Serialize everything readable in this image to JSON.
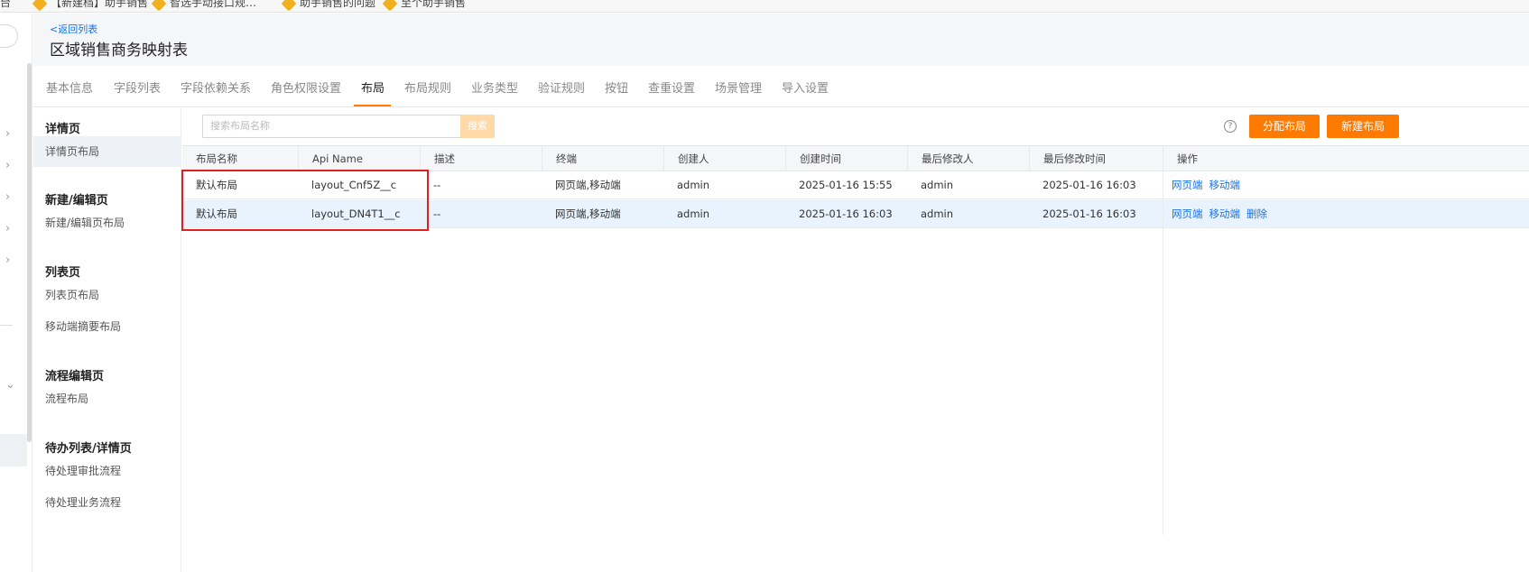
{
  "bookmarks": [
    "台",
    "【新建档】助手销售",
    "智选手动接口规…",
    "助手销售的问题",
    "至个助手销售"
  ],
  "header": {
    "back_label": "<返回列表",
    "title": "区域销售商务映射表"
  },
  "tabs": [
    {
      "label": "基本信息"
    },
    {
      "label": "字段列表"
    },
    {
      "label": "字段依赖关系"
    },
    {
      "label": "角色权限设置"
    },
    {
      "label": "布局",
      "active": true
    },
    {
      "label": "布局规则"
    },
    {
      "label": "业务类型"
    },
    {
      "label": "验证规则"
    },
    {
      "label": "按钮"
    },
    {
      "label": "查重设置"
    },
    {
      "label": "场景管理"
    },
    {
      "label": "导入设置"
    }
  ],
  "sidebar": {
    "sections": [
      {
        "title": "详情页",
        "items": [
          {
            "label": "详情页布局",
            "active": true
          }
        ]
      },
      {
        "title": "新建/编辑页",
        "items": [
          {
            "label": "新建/编辑页布局"
          }
        ]
      },
      {
        "title": "列表页",
        "items": [
          {
            "label": "列表页布局"
          },
          {
            "label": "移动端摘要布局"
          }
        ]
      },
      {
        "title": "流程编辑页",
        "items": [
          {
            "label": "流程布局"
          }
        ]
      },
      {
        "title": "待办列表/详情页",
        "items": [
          {
            "label": "待处理审批流程"
          },
          {
            "label": "待处理业务流程"
          }
        ]
      }
    ]
  },
  "toolbar": {
    "search_placeholder": "搜索布局名称",
    "search_button": "搜索",
    "assign_button": "分配布局",
    "new_button": "新建布局",
    "help_icon": "?"
  },
  "table": {
    "columns": [
      "布局名称",
      "Api Name",
      "描述",
      "终端",
      "创建人",
      "创建时间",
      "最后修改人",
      "最后修改时间",
      "操作"
    ],
    "rows": [
      {
        "name": "默认布局",
        "api": "layout_Cnf5Z__c",
        "desc": "--",
        "terminal": "网页端,移动端",
        "creator": "admin",
        "created": "2025-01-16 15:55",
        "modifier": "admin",
        "modified": "2025-01-16 16:03",
        "ops": [
          "网页端",
          "移动端"
        ]
      },
      {
        "name": "默认布局",
        "api": "layout_DN4T1__c",
        "desc": "--",
        "terminal": "网页端,移动端",
        "creator": "admin",
        "created": "2025-01-16 16:03",
        "modifier": "admin",
        "modified": "2025-01-16 16:03",
        "ops": [
          "网页端",
          "移动端",
          "删除"
        ],
        "highlighted": true
      }
    ]
  },
  "colors": {
    "accent": "#ff7a00",
    "link": "#1a73e8",
    "annotation_box": "#e02020",
    "row_highlight": "#e8f3fd"
  }
}
